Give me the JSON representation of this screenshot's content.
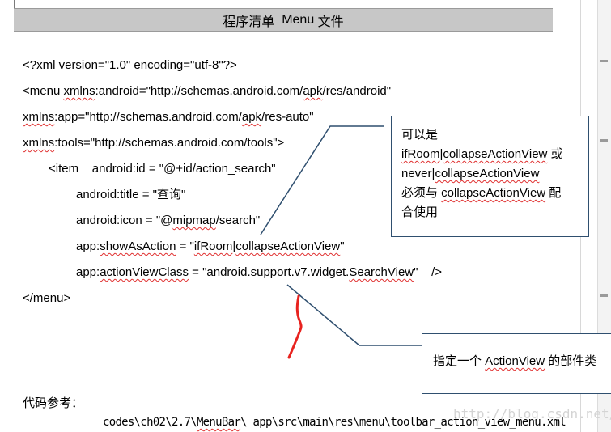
{
  "title": {
    "prefix": "程序清单  ",
    "menu_word": "Menu",
    "suffix": " 文件"
  },
  "code": {
    "line1": "<?xml version=\"1.0\" encoding=\"utf-8\"?>",
    "line2_a": "<menu ",
    "line2_b": "xmlns",
    "line2_c": ":android=\"http://schemas.android.com/",
    "line2_d": "apk",
    "line2_e": "/res/android\"",
    "line3_a": "xmlns",
    "line3_b": ":app=\"http://schemas.android.com/",
    "line3_c": "apk",
    "line3_d": "/res-auto\"",
    "line4_a": "xmlns",
    "line4_b": ":tools=\"http://schemas.android.com/tools\">",
    "line5": "<item    android:id = \"@+id/action_search\"",
    "line6": "android:title = \"查询\"",
    "line7_a": "android:icon = \"@",
    "line7_b": "mipmap",
    "line7_c": "/search\"",
    "line8_a": "app:",
    "line8_b": "showAsAction",
    "line8_c": " = \"",
    "line8_d": "ifRoom",
    "line8_e": "|",
    "line8_f": "collapseActionView",
    "line8_g": "\"",
    "line9_a": "app:",
    "line9_b": "actionViewClass",
    "line9_c": " = \"android.support.v7.widget.",
    "line9_d": "SearchView",
    "line9_e": "\"    />",
    "line10": "</menu>"
  },
  "callout1": {
    "l1": "可以是",
    "l2_a": "ifRoom",
    "l2_b": "|",
    "l2_c": "collapseActionView",
    "l2_d": " 或",
    "l3_a": "never",
    "l3_b": "|",
    "l3_c": "collapseActionView",
    "l4_a": "必须与 ",
    "l4_b": "collapseActionView",
    "l4_c": " 配",
    "l5": "合使用"
  },
  "callout2": {
    "a": "指定一个 ",
    "b": "ActionView",
    "c": " 的部件类"
  },
  "reference": {
    "label": "代码参考：",
    "path_a": "codes\\ch02\\2.7\\",
    "path_b": "MenuBar",
    "path_c": "\\ app\\src\\main\\res\\menu\\toolbar_action_view_menu.xml"
  },
  "watermark": "http://blog.csdn.net/",
  "colors": {
    "title_bar": "#c7c7c7",
    "callout_border": "#2f4f6f",
    "spellcheck": "#e03030",
    "pen_mark": "#e8231f"
  }
}
